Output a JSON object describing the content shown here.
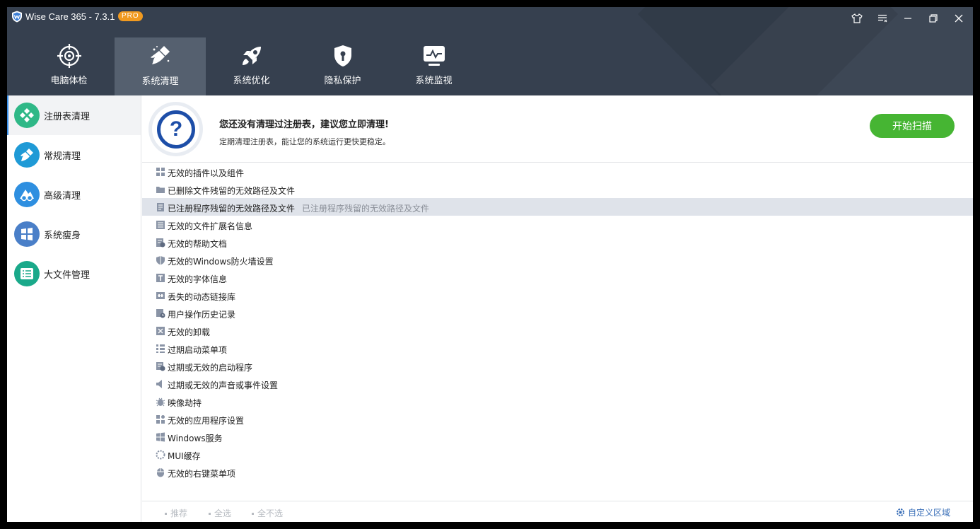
{
  "window": {
    "title": "Wise Care 365 - 7.3.1",
    "badge": "PRO"
  },
  "nav": {
    "tabs": [
      {
        "label": "电脑体检",
        "icon": "crosshair-icon"
      },
      {
        "label": "系统清理",
        "icon": "broom-icon",
        "active": true
      },
      {
        "label": "系统优化",
        "icon": "rocket-icon"
      },
      {
        "label": "隐私保护",
        "icon": "shield-lock-icon"
      },
      {
        "label": "系统监视",
        "icon": "monitor-pulse-icon"
      }
    ]
  },
  "sidebar": {
    "items": [
      {
        "label": "注册表清理",
        "icon": "registry-icon",
        "color": "#2fb887",
        "active": true
      },
      {
        "label": "常规清理",
        "icon": "broom-icon",
        "color": "#1f9ad6"
      },
      {
        "label": "高级清理",
        "icon": "advanced-clean-icon",
        "color": "#2e8fe0"
      },
      {
        "label": "系统瘦身",
        "icon": "windows-icon",
        "color": "#4a7fc8"
      },
      {
        "label": "大文件管理",
        "icon": "file-list-icon",
        "color": "#1aa98a"
      }
    ]
  },
  "banner": {
    "headline": "您还没有清理过注册表，建议您立即清理!",
    "subtext": "定期清理注册表，能让您的系统运行更快更稳定。",
    "scan_label": "开始扫描"
  },
  "registry_items": [
    {
      "label": "无效的插件以及组件",
      "icon": "grid-icon"
    },
    {
      "label": "已删除文件残留的无效路径及文件",
      "icon": "folder-icon"
    },
    {
      "label": "已注册程序残留的无效路径及文件",
      "icon": "document-icon",
      "desc": "已注册程序残留的无效路径及文件",
      "highlighted": true
    },
    {
      "label": "无效的文件扩展名信息",
      "icon": "list-icon"
    },
    {
      "label": "无效的帮助文档",
      "icon": "help-doc-icon"
    },
    {
      "label": "无效的Windows防火墙设置",
      "icon": "firewall-icon"
    },
    {
      "label": "无效的字体信息",
      "icon": "font-icon"
    },
    {
      "label": "丢失的动态链接库",
      "icon": "dll-icon"
    },
    {
      "label": "用户操作历史记录",
      "icon": "history-icon"
    },
    {
      "label": "无效的卸载",
      "icon": "uninstall-icon"
    },
    {
      "label": "过期启动菜单项",
      "icon": "start-menu-icon"
    },
    {
      "label": "过期或无效的启动程序",
      "icon": "startup-icon"
    },
    {
      "label": "过期或无效的声音或事件设置",
      "icon": "speaker-icon"
    },
    {
      "label": "映像劫持",
      "icon": "bug-icon"
    },
    {
      "label": "无效的应用程序设置",
      "icon": "app-settings-icon"
    },
    {
      "label": "Windows服务",
      "icon": "windows-icon"
    },
    {
      "label": "MUI缓存",
      "icon": "cache-icon"
    },
    {
      "label": "无效的右键菜单项",
      "icon": "mouse-icon"
    }
  ],
  "footer": {
    "recommend": "推荐",
    "select_all": "全选",
    "select_none": "全不选",
    "custom_area": "自定义区域"
  },
  "colors": {
    "header_bg": "#36404f",
    "accent_green": "#46b533",
    "highlight_row": "#dfe3ea",
    "link_blue": "#3a6fb8"
  }
}
